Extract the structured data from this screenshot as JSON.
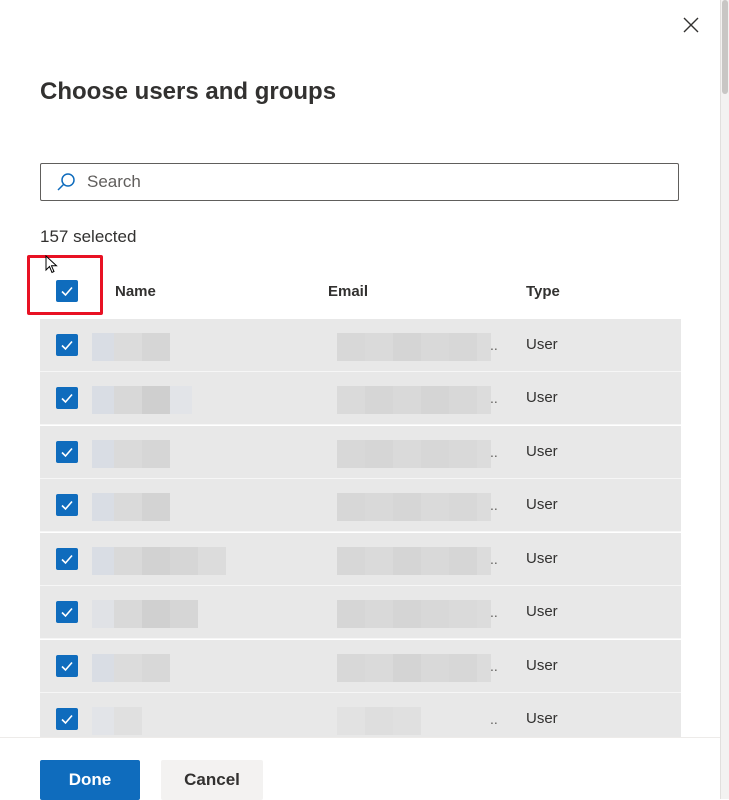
{
  "dialog": {
    "title": "Choose users and groups",
    "close_icon": "close-icon"
  },
  "search": {
    "placeholder": "Search",
    "value": "",
    "icon": "search-icon"
  },
  "selection": {
    "count_text": "157 selected",
    "select_all_checked": true
  },
  "table": {
    "columns": [
      "Name",
      "Email",
      "Type"
    ],
    "rows": [
      {
        "checked": true,
        "type": "User",
        "ellipsis": ".."
      },
      {
        "checked": true,
        "type": "User",
        "ellipsis": ".."
      },
      {
        "checked": true,
        "type": "User",
        "ellipsis": ".."
      },
      {
        "checked": true,
        "type": "User",
        "ellipsis": ".."
      },
      {
        "checked": true,
        "type": "User",
        "ellipsis": ".."
      },
      {
        "checked": true,
        "type": "User",
        "ellipsis": ".."
      },
      {
        "checked": true,
        "type": "User",
        "ellipsis": ".."
      },
      {
        "checked": true,
        "type": "User",
        "ellipsis": ".."
      }
    ]
  },
  "footer": {
    "done_label": "Done",
    "cancel_label": "Cancel"
  },
  "colors": {
    "accent": "#0f6cbd",
    "highlight": "#e81123",
    "row_bg": "#e8e8e8"
  }
}
